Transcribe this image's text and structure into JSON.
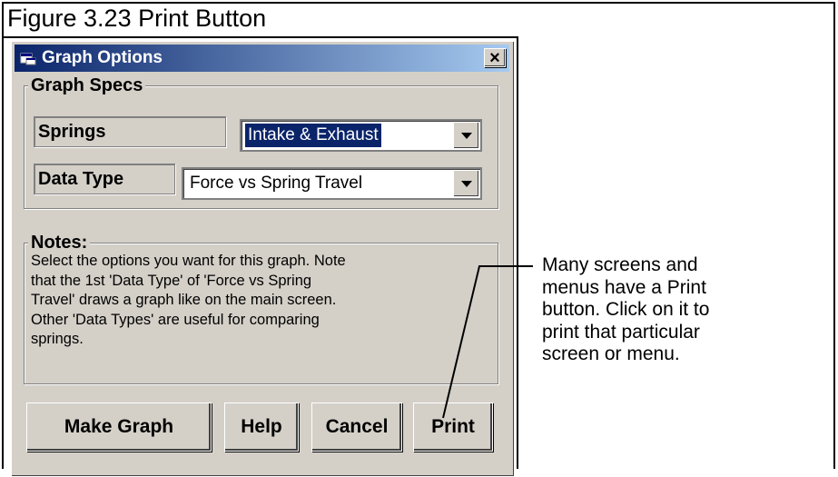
{
  "figure": {
    "caption": "Figure 3.23  Print Button"
  },
  "dialog": {
    "title": "Graph Options",
    "close_glyph": "×",
    "graph_specs": {
      "legend": "Graph Specs",
      "springs_label": "Springs",
      "springs_value": "Intake & Exhaust",
      "data_type_label": "Data Type",
      "data_type_value": "Force vs Spring Travel"
    },
    "notes": {
      "legend": "Notes:",
      "lines": [
        "Select the options you want for this graph.  Note",
        "that the 1st 'Data Type' of 'Force vs Spring",
        "Travel' draws a graph like on the main screen.",
        "Other 'Data Types' are useful for comparing",
        "springs."
      ]
    },
    "buttons": {
      "make_graph": "Make Graph",
      "help": "Help",
      "cancel": "Cancel",
      "print": "Print"
    }
  },
  "callout": {
    "lines": [
      "Many screens and",
      "menus have a Print",
      "button.  Click on it to",
      "print that particular",
      "screen or menu."
    ]
  },
  "colors": {
    "titlebar_start": "#0a246a",
    "titlebar_end": "#a6caf0",
    "dialog_face": "#d4d0c8",
    "selection": "#0a246a"
  },
  "icons": {
    "title_icon": "window-icon",
    "close_icon": "close-icon",
    "dropdown_icon": "chevron-down-icon"
  }
}
